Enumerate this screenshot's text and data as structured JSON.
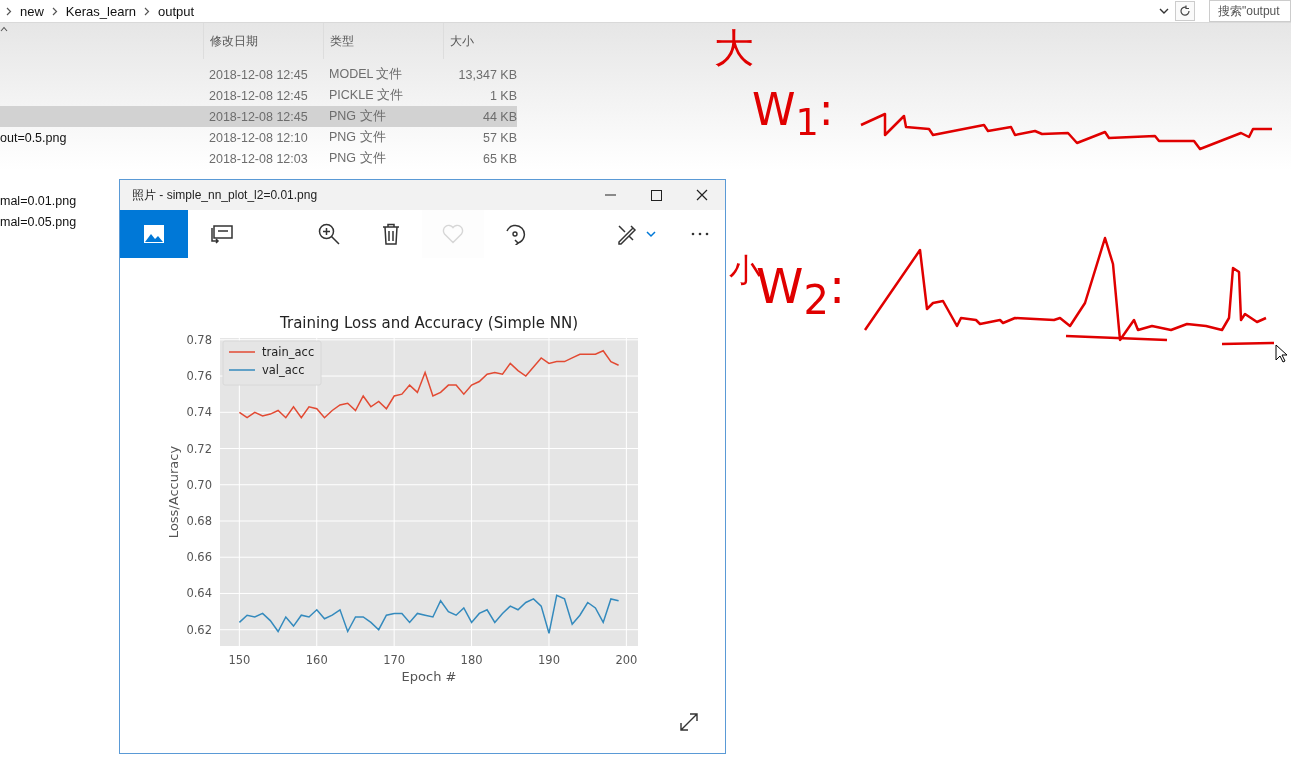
{
  "explorer": {
    "breadcrumb": [
      "new",
      "Keras_learn",
      "output"
    ],
    "search": {
      "placeholder": "搜索\"output"
    },
    "columns": [
      "修改日期",
      "类型",
      "大小"
    ],
    "rows": [
      {
        "date": "2018-12-08 12:45",
        "type": "MODEL 文件",
        "size": "13,347 KB",
        "selected": false
      },
      {
        "date": "2018-12-08 12:45",
        "type": "PICKLE 文件",
        "size": "1 KB",
        "selected": false
      },
      {
        "date": "2018-12-08 12:45",
        "type": "PNG 文件",
        "size": "44 KB",
        "selected": true
      },
      {
        "name": "out=0.5.png",
        "date": "2018-12-08 12:10",
        "type": "PNG 文件",
        "size": "57 KB",
        "selected": false
      },
      {
        "date": "2018-12-08 12:03",
        "type": "PNG 文件",
        "size": "65 KB",
        "selected": false
      },
      {
        "name": "mal=0.01.png",
        "selected": false
      },
      {
        "name": "mal=0.05.png",
        "selected": false
      }
    ]
  },
  "photo_window": {
    "title": "照片 - simple_nn_plot_l2=0.01.png",
    "toolbar": [
      {
        "kind": "picture",
        "selected": true,
        "disabled": false
      },
      {
        "kind": "slideshow",
        "selected": false,
        "disabled": false
      },
      {
        "kind": "zoom",
        "selected": false,
        "disabled": false
      },
      {
        "kind": "delete",
        "selected": false,
        "disabled": false
      },
      {
        "kind": "favorite",
        "selected": false,
        "disabled": true
      },
      {
        "kind": "rotate",
        "selected": false,
        "disabled": false
      },
      {
        "kind": "edit",
        "selected": false,
        "disabled": false
      },
      {
        "kind": "more",
        "selected": false,
        "disabled": false
      }
    ],
    "chart_data": {
      "type": "line",
      "grid": true,
      "legend": true,
      "title": "Training Loss and Accuracy (Simple NN)",
      "xlabel": "Epoch #",
      "ylabel": "Loss/Accuracy",
      "x": [
        150,
        151,
        152,
        153,
        154,
        155,
        156,
        157,
        158,
        159,
        160,
        161,
        162,
        163,
        164,
        165,
        166,
        167,
        168,
        169,
        170,
        171,
        172,
        173,
        174,
        175,
        176,
        177,
        178,
        179,
        180,
        181,
        182,
        183,
        184,
        185,
        186,
        187,
        188,
        189,
        190,
        191,
        192,
        193,
        194,
        195,
        196,
        197,
        198,
        199
      ],
      "series": [
        {
          "name": "train_acc",
          "color": "#e24a33",
          "values": [
            0.74,
            0.737,
            0.74,
            0.738,
            0.739,
            0.741,
            0.737,
            0.743,
            0.737,
            0.743,
            0.742,
            0.737,
            0.741,
            0.744,
            0.745,
            0.741,
            0.749,
            0.743,
            0.746,
            0.742,
            0.749,
            0.75,
            0.755,
            0.751,
            0.762,
            0.749,
            0.751,
            0.755,
            0.755,
            0.75,
            0.755,
            0.757,
            0.761,
            0.762,
            0.761,
            0.767,
            0.763,
            0.76,
            0.765,
            0.77,
            0.767,
            0.768,
            0.768,
            0.77,
            0.772,
            0.772,
            0.772,
            0.774,
            0.768,
            0.766
          ]
        },
        {
          "name": "val_acc",
          "color": "#348abd",
          "values": [
            0.624,
            0.628,
            0.627,
            0.629,
            0.625,
            0.619,
            0.627,
            0.622,
            0.628,
            0.627,
            0.631,
            0.626,
            0.628,
            0.631,
            0.619,
            0.627,
            0.627,
            0.624,
            0.62,
            0.628,
            0.629,
            0.629,
            0.624,
            0.629,
            0.628,
            0.627,
            0.636,
            0.63,
            0.628,
            0.632,
            0.624,
            0.629,
            0.631,
            0.624,
            0.629,
            0.633,
            0.631,
            0.635,
            0.637,
            0.633,
            0.618,
            0.639,
            0.637,
            0.623,
            0.628,
            0.635,
            0.632,
            0.624,
            0.637,
            0.636
          ]
        }
      ],
      "xlim": [
        147.5,
        201.5
      ],
      "ylim": [
        0.611,
        0.781
      ],
      "xticks": [
        150,
        160,
        170,
        180,
        190,
        200
      ],
      "yticks": [
        {
          "value": 0.62,
          "label": "0.62"
        },
        {
          "value": 0.64,
          "label": "0.64"
        },
        {
          "value": 0.66,
          "label": "0.66"
        },
        {
          "value": 0.68,
          "label": "0.68"
        },
        {
          "value": 0.7,
          "label": "0.70"
        },
        {
          "value": 0.72,
          "label": "0.72"
        },
        {
          "value": 0.74,
          "label": "0.74"
        },
        {
          "value": 0.76,
          "label": "0.76"
        },
        {
          "value": 0.78,
          "label": "0.78"
        }
      ]
    }
  },
  "handwriting": [
    "大",
    "W$_{1}$:",
    "小",
    "W$_{2}$:"
  ]
}
